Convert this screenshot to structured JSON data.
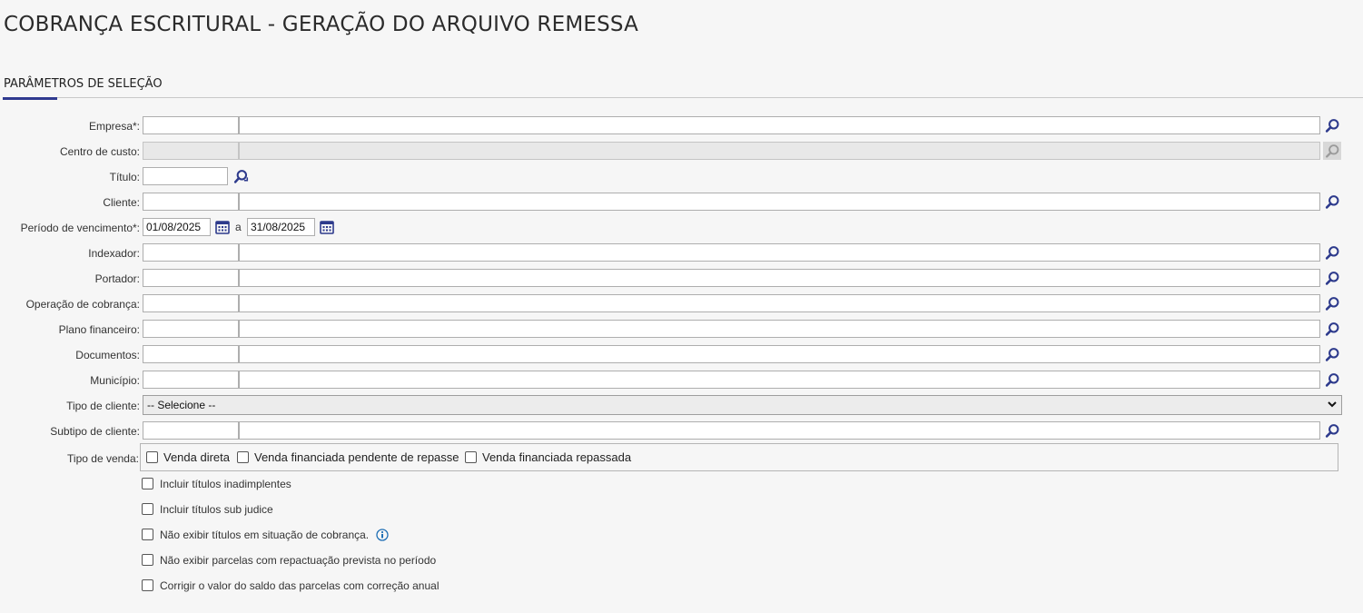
{
  "page_title": "COBRANÇA ESCRITURAL - GERAÇÃO DO ARQUIVO REMESSA",
  "section_title": "PARÂMETROS DE SELEÇÃO",
  "fields": {
    "empresa": "Empresa*:",
    "centro_custo": "Centro de custo:",
    "titulo": "Título:",
    "cliente": "Cliente:",
    "periodo": "Período de vencimento*:",
    "indexador": "Indexador:",
    "portador": "Portador:",
    "operacao": "Operação de cobrança:",
    "plano": "Plano financeiro:",
    "documentos": "Documentos:",
    "municipio": "Município:",
    "tipo_cliente": "Tipo de cliente:",
    "subtipo_cliente": "Subtipo de cliente:",
    "tipo_venda": "Tipo de venda:"
  },
  "periodo": {
    "start": "01/08/2025",
    "separator": "a",
    "end": "31/08/2025"
  },
  "tipo_cliente_selected": "-- Selecione --",
  "tipo_venda_options": [
    "Venda direta",
    "Venda financiada pendente de repasse",
    "Venda financiada repassada"
  ],
  "checkboxes": [
    "Incluir títulos inadimplentes",
    "Incluir títulos sub judice",
    "Não exibir títulos em situação de cobrança.",
    "Não exibir parcelas com repactuação prevista no período",
    "Corrigir o valor do saldo das parcelas com correção anual"
  ],
  "colors": {
    "accent": "#2f3a8f",
    "icon": "#2d3a8c",
    "disabled_icon": "#9a9a9a",
    "info": "#1f6fb5"
  },
  "icons": {
    "search": "search-icon",
    "calendar": "calendar-icon",
    "info": "info-icon"
  }
}
